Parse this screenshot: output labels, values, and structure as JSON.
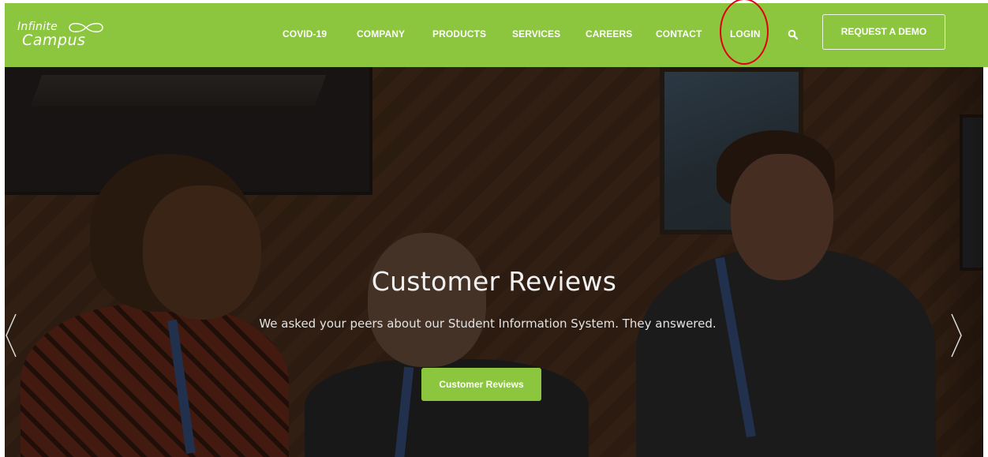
{
  "brand": {
    "logo_line1": "Infinite",
    "logo_line2": "Campus",
    "color": "#8cc63f"
  },
  "nav": {
    "items": [
      {
        "label": "COVID-19"
      },
      {
        "label": "COMPANY"
      },
      {
        "label": "PRODUCTS"
      },
      {
        "label": "SERVICES"
      },
      {
        "label": "CAREERS"
      },
      {
        "label": "CONTACT"
      },
      {
        "label": "LOGIN"
      }
    ],
    "search_icon": "search-icon",
    "cta_label": "REQUEST A DEMO"
  },
  "annotation": {
    "color": "#e0000f",
    "target": "LOGIN"
  },
  "hero": {
    "title": "Customer Reviews",
    "subtitle": "We asked your peers about our Student Information System. They answered.",
    "button_label": "Customer Reviews",
    "prev_icon": "chevron-left-icon",
    "next_icon": "chevron-right-icon"
  }
}
